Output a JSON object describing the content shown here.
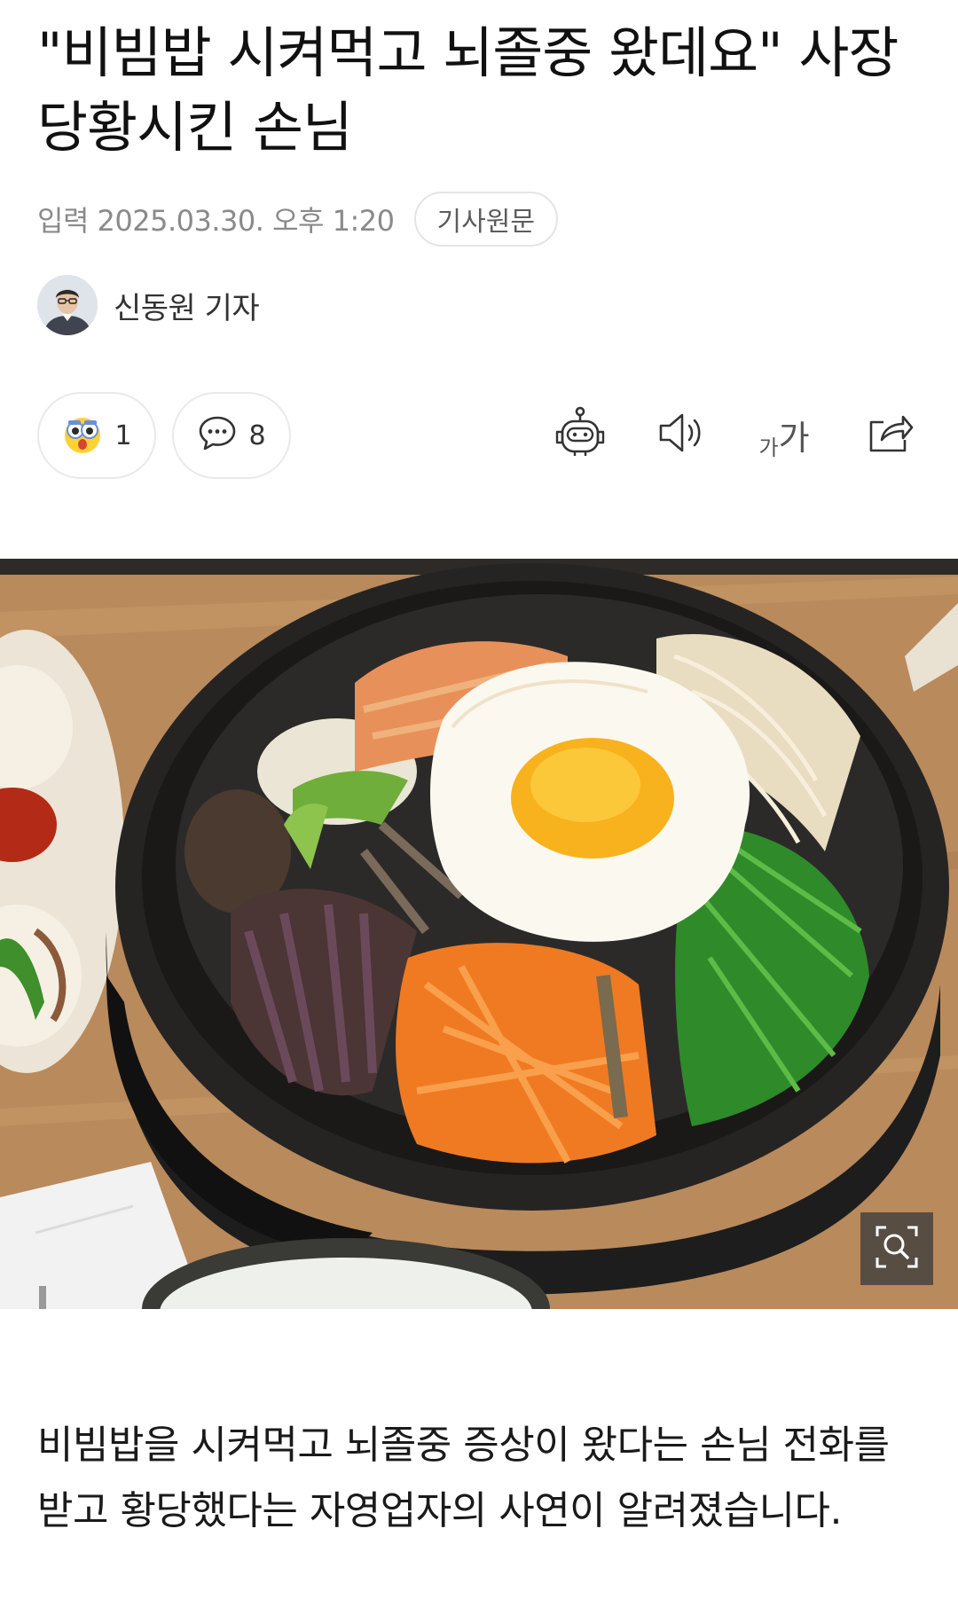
{
  "article": {
    "headline": "\"비빔밥 시켜먹고 뇌졸중 왔데요\" 사장 당황시킨 손님",
    "date": "입력 2025.03.30. 오후 1:20",
    "source_button": "기사원문",
    "reporter": "신동원 기자",
    "body_first_paragraph": "비빔밥을 시켜먹고 뇌졸중 증상이 왔다는 손님 전화를 받고 황당했다는 자영업자의 사연이 알려졌습니다."
  },
  "actions": {
    "reaction_count": "1",
    "comment_count": "8",
    "font_small_glyph": "가",
    "font_large_glyph": "가"
  },
  "icons": {
    "reaction": "surprised-emoji-icon",
    "comment": "speech-bubble-icon",
    "summary": "robot-icon",
    "listen": "speaker-icon",
    "font": "font-size-icon",
    "share": "share-icon",
    "zoom": "zoom-search-icon"
  },
  "colors": {
    "text": "#111111",
    "meta": "#8a8a8a",
    "border": "#e4e4e4"
  }
}
